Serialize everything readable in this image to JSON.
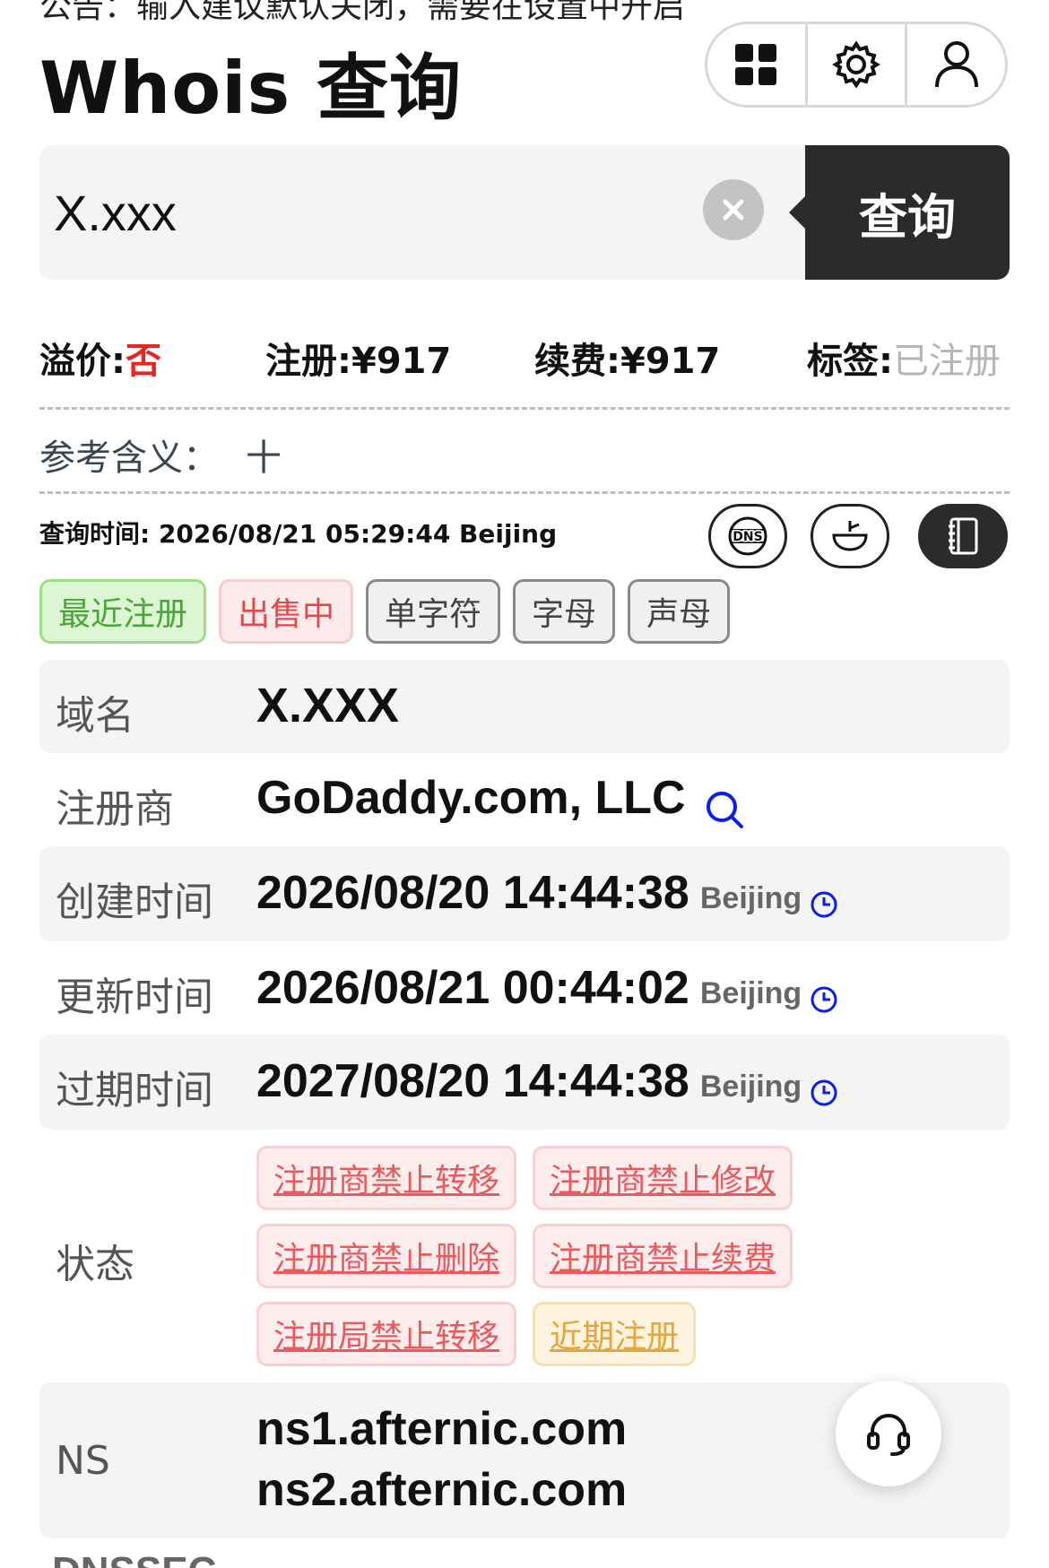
{
  "notice": "公告：输入建议默认关闭，需要在设置中开启",
  "page_title": "Whois 查询",
  "search": {
    "value": "X.xxx",
    "button_label": "查询"
  },
  "pricing": {
    "premium_label": "溢价:",
    "premium_value": "否",
    "register_label": "注册:",
    "register_value": "¥917",
    "renew_label": "续费:",
    "renew_value": "¥917",
    "tag_label": "标签:",
    "tag_value": "已注册"
  },
  "meaning": {
    "label": "参考含义：",
    "value": "十"
  },
  "query_time": "查询时间: 2026/08/21 05:29:44 Beijing",
  "tags": [
    "最近注册",
    "出售中",
    "单字符",
    "字母",
    "声母"
  ],
  "whois": {
    "domain_label": "域名",
    "domain_value": "X.XXX",
    "registrar_label": "注册商",
    "registrar_value": "GoDaddy.com, LLC",
    "created_label": "创建时间",
    "created_value": "2026/08/20 14:44:38",
    "created_tz": "Beijing",
    "updated_label": "更新时间",
    "updated_value": "2026/08/21 00:44:02",
    "updated_tz": "Beijing",
    "expires_label": "过期时间",
    "expires_value": "2027/08/20 14:44:38",
    "expires_tz": "Beijing",
    "status_label": "状态",
    "statuses": [
      "注册商禁止转移",
      "注册商禁止修改",
      "注册商禁止删除",
      "注册商禁止续费",
      "注册局禁止转移",
      "近期注册"
    ],
    "ns_label": "NS",
    "ns_values": [
      "ns1.afternic.com",
      "ns2.afternic.com"
    ]
  },
  "bottom_peek": "DNSSEC",
  "colors": {
    "accent_dark": "#2b2b2b",
    "domain_blue": "#0b1ef0",
    "warn_red": "#e8251e"
  },
  "icons": [
    "apps-grid-icon",
    "gear-icon",
    "user-icon",
    "clear-icon",
    "dns-icon",
    "bowl-icon",
    "notebook-icon",
    "magnifier-icon",
    "clock-icon",
    "headset-icon"
  ]
}
